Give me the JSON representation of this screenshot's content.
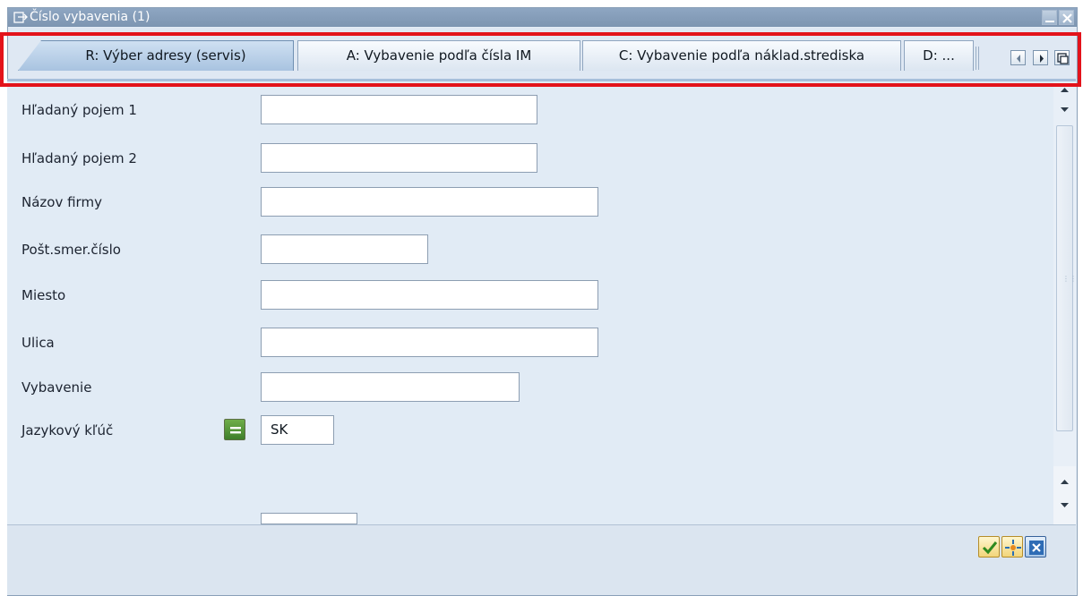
{
  "window": {
    "title": "Číslo vybavenia (1)",
    "title_icon": "dialog-arrow-icon"
  },
  "tabs": [
    {
      "label": "R: Výber adresy (servis)",
      "active": true
    },
    {
      "label": "A: Vybavenie podľa čísla IM",
      "active": false
    },
    {
      "label": "C: Vybavenie podľa náklad.strediska",
      "active": false
    },
    {
      "label": "D: ...",
      "active": false
    }
  ],
  "fields": [
    {
      "label": "Hľadaný pojem 1",
      "value": ""
    },
    {
      "label": "Hľadaný pojem 2",
      "value": ""
    },
    {
      "label": "Názov firmy",
      "value": ""
    },
    {
      "label": "Pošt.smer.číslo",
      "value": ""
    },
    {
      "label": "Miesto",
      "value": ""
    },
    {
      "label": "Ulica",
      "value": ""
    },
    {
      "label": "Vybavenie",
      "value": ""
    },
    {
      "label": "Jazykový kľúč",
      "value": "SK"
    }
  ],
  "colors": {
    "highlight": "#e3131b",
    "window_bg": "#e4edf6",
    "titlebar": "#8ea6c2"
  },
  "footer": {
    "buttons": [
      "check-icon",
      "multi-select-icon",
      "cancel-icon"
    ]
  }
}
